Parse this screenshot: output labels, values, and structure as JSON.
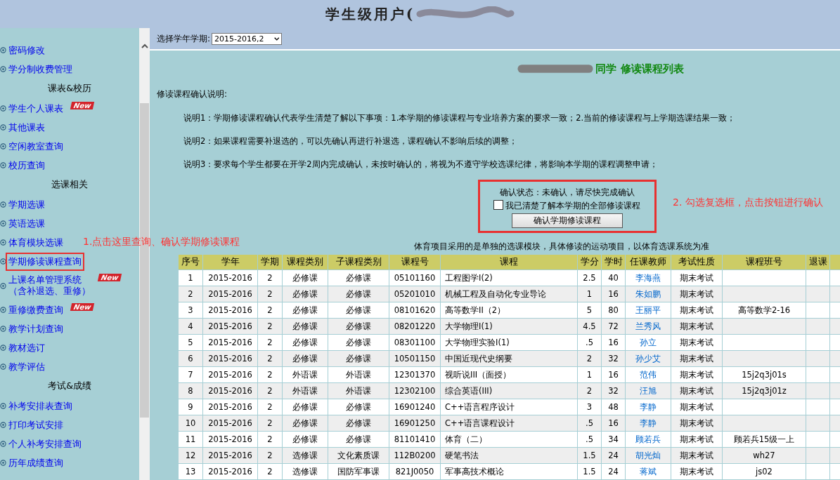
{
  "header": {
    "title": "学生级用户("
  },
  "sidebar": {
    "items": [
      {
        "kind": "link",
        "label": "密码修改"
      },
      {
        "kind": "link",
        "label": "学分制收费管理"
      },
      {
        "kind": "heading",
        "label": "课表&校历"
      },
      {
        "kind": "link",
        "label": "学生个人课表",
        "badge": "New"
      },
      {
        "kind": "link",
        "label": "其他课表"
      },
      {
        "kind": "link",
        "label": "空闲教室查询"
      },
      {
        "kind": "link",
        "label": "校历查询"
      },
      {
        "kind": "heading",
        "label": "选课相关"
      },
      {
        "kind": "link",
        "label": "学期选课"
      },
      {
        "kind": "link",
        "label": "英语选课"
      },
      {
        "kind": "link",
        "label": "体育模块选课"
      },
      {
        "kind": "link",
        "label": "学期修读课程查询",
        "highlighted": true
      },
      {
        "kind": "link",
        "label": "上课名单管理系统",
        "sublabel": "（含补退选、重修）",
        "badge": "New"
      },
      {
        "kind": "link",
        "label": "重修缴费查询",
        "badge": "New"
      },
      {
        "kind": "link",
        "label": "教学计划查询"
      },
      {
        "kind": "link",
        "label": "教材选订"
      },
      {
        "kind": "link",
        "label": "教学评估"
      },
      {
        "kind": "heading",
        "label": "考试&成绩"
      },
      {
        "kind": "link",
        "label": "补考安排表查询"
      },
      {
        "kind": "link",
        "label": "打印考试安排"
      },
      {
        "kind": "link",
        "label": "个人补考安排查询"
      },
      {
        "kind": "link",
        "label": "历年成绩查询"
      }
    ]
  },
  "term_select": {
    "label": "选择学年学期:",
    "value": "2015-2016,2"
  },
  "page_title": "同学 修读课程列表",
  "notes": {
    "heading": "修读课程确认说明:",
    "lines": [
      "说明1：学期修读课程确认代表学生清楚了解以下事项：1.本学期的修读课程与专业培养方案的要求一致；2.当前的修读课程与上学期选课结果一致；",
      "说明2：如果课程需要补退选的，可以先确认再进行补退选，课程确认不影响后续的调整；",
      "说明3：要求每个学生都要在开学2周内完成确认，未按时确认的，将视为不遵守学校选课纪律，将影响本学期的课程调整申请；"
    ]
  },
  "confirm": {
    "status": "确认状态：未确认，请尽快完成确认",
    "checkbox_label": "我已清楚了解本学期的全部修读课程",
    "checked": false,
    "button": "确认学期修读课程"
  },
  "pe_note": "体育项目采用的是单独的选课模块，具体修读的运动项目，以体育选课系统为准",
  "annotations": [
    "1.点击这里查询、确认学期修读课程",
    "2. 勾选复选框，点击按钮进行确认"
  ],
  "table": {
    "columns": [
      "序号",
      "学年",
      "学期",
      "课程类别",
      "子课程类别",
      "课程号",
      "课程",
      "学分",
      "学时",
      "任课教师",
      "考试性质",
      "课程班号",
      "退课"
    ],
    "rows": [
      [
        "1",
        "2015-2016",
        "2",
        "必修课",
        "必修课",
        "05101160",
        "工程图学Ⅰ(2)",
        "2.5",
        "40",
        "李海燕",
        "期末考试",
        ""
      ],
      [
        "2",
        "2015-2016",
        "2",
        "必修课",
        "必修课",
        "05201010",
        "机械工程及自动化专业导论",
        "1",
        "16",
        "朱如鹏",
        "期末考试",
        ""
      ],
      [
        "3",
        "2015-2016",
        "2",
        "必修课",
        "必修课",
        "08101620",
        "高等数学II（2）",
        "5",
        "80",
        "王丽平",
        "期末考试",
        "高等数学2-16"
      ],
      [
        "4",
        "2015-2016",
        "2",
        "必修课",
        "必修课",
        "08201220",
        "大学物理Ⅰ(1)",
        "4.5",
        "72",
        "兰秀风",
        "期末考试",
        ""
      ],
      [
        "5",
        "2015-2016",
        "2",
        "必修课",
        "必修课",
        "08301100",
        "大学物理实验Ⅰ(1)",
        ".5",
        "16",
        "孙立",
        "期末考试",
        ""
      ],
      [
        "6",
        "2015-2016",
        "2",
        "必修课",
        "必修课",
        "10501150",
        "中国近现代史纲要",
        "2",
        "32",
        "孙少艾",
        "期末考试",
        ""
      ],
      [
        "7",
        "2015-2016",
        "2",
        "外语课",
        "外语课",
        "12301370",
        "视听说III（面授）",
        "1",
        "16",
        "范伟",
        "期末考试",
        "15j2q3j01s"
      ],
      [
        "8",
        "2015-2016",
        "2",
        "外语课",
        "外语课",
        "12302100",
        "综合英语(III)",
        "2",
        "32",
        "汪旭",
        "期末考试",
        "15j2q3j01z"
      ],
      [
        "9",
        "2015-2016",
        "2",
        "必修课",
        "必修课",
        "16901240",
        "C++语言程序设计",
        "3",
        "48",
        "李静",
        "期末考试",
        ""
      ],
      [
        "10",
        "2015-2016",
        "2",
        "必修课",
        "必修课",
        "16901250",
        "C++语言课程设计",
        ".5",
        "16",
        "李静",
        "期末考试",
        ""
      ],
      [
        "11",
        "2015-2016",
        "2",
        "必修课",
        "必修课",
        "81101410",
        "体育（二）",
        ".5",
        "34",
        "顾若兵",
        "期末考试",
        "顾若兵15级一上"
      ],
      [
        "12",
        "2015-2016",
        "2",
        "选修课",
        "文化素质课",
        "112B0200",
        "硬笔书法",
        "1.5",
        "24",
        "胡光灿",
        "期末考试",
        "wh27"
      ],
      [
        "13",
        "2015-2016",
        "2",
        "选修课",
        "国防军事课",
        "821J0050",
        "军事高技术概论",
        "1.5",
        "24",
        "蒋斌",
        "期末考试",
        "js02"
      ]
    ]
  }
}
